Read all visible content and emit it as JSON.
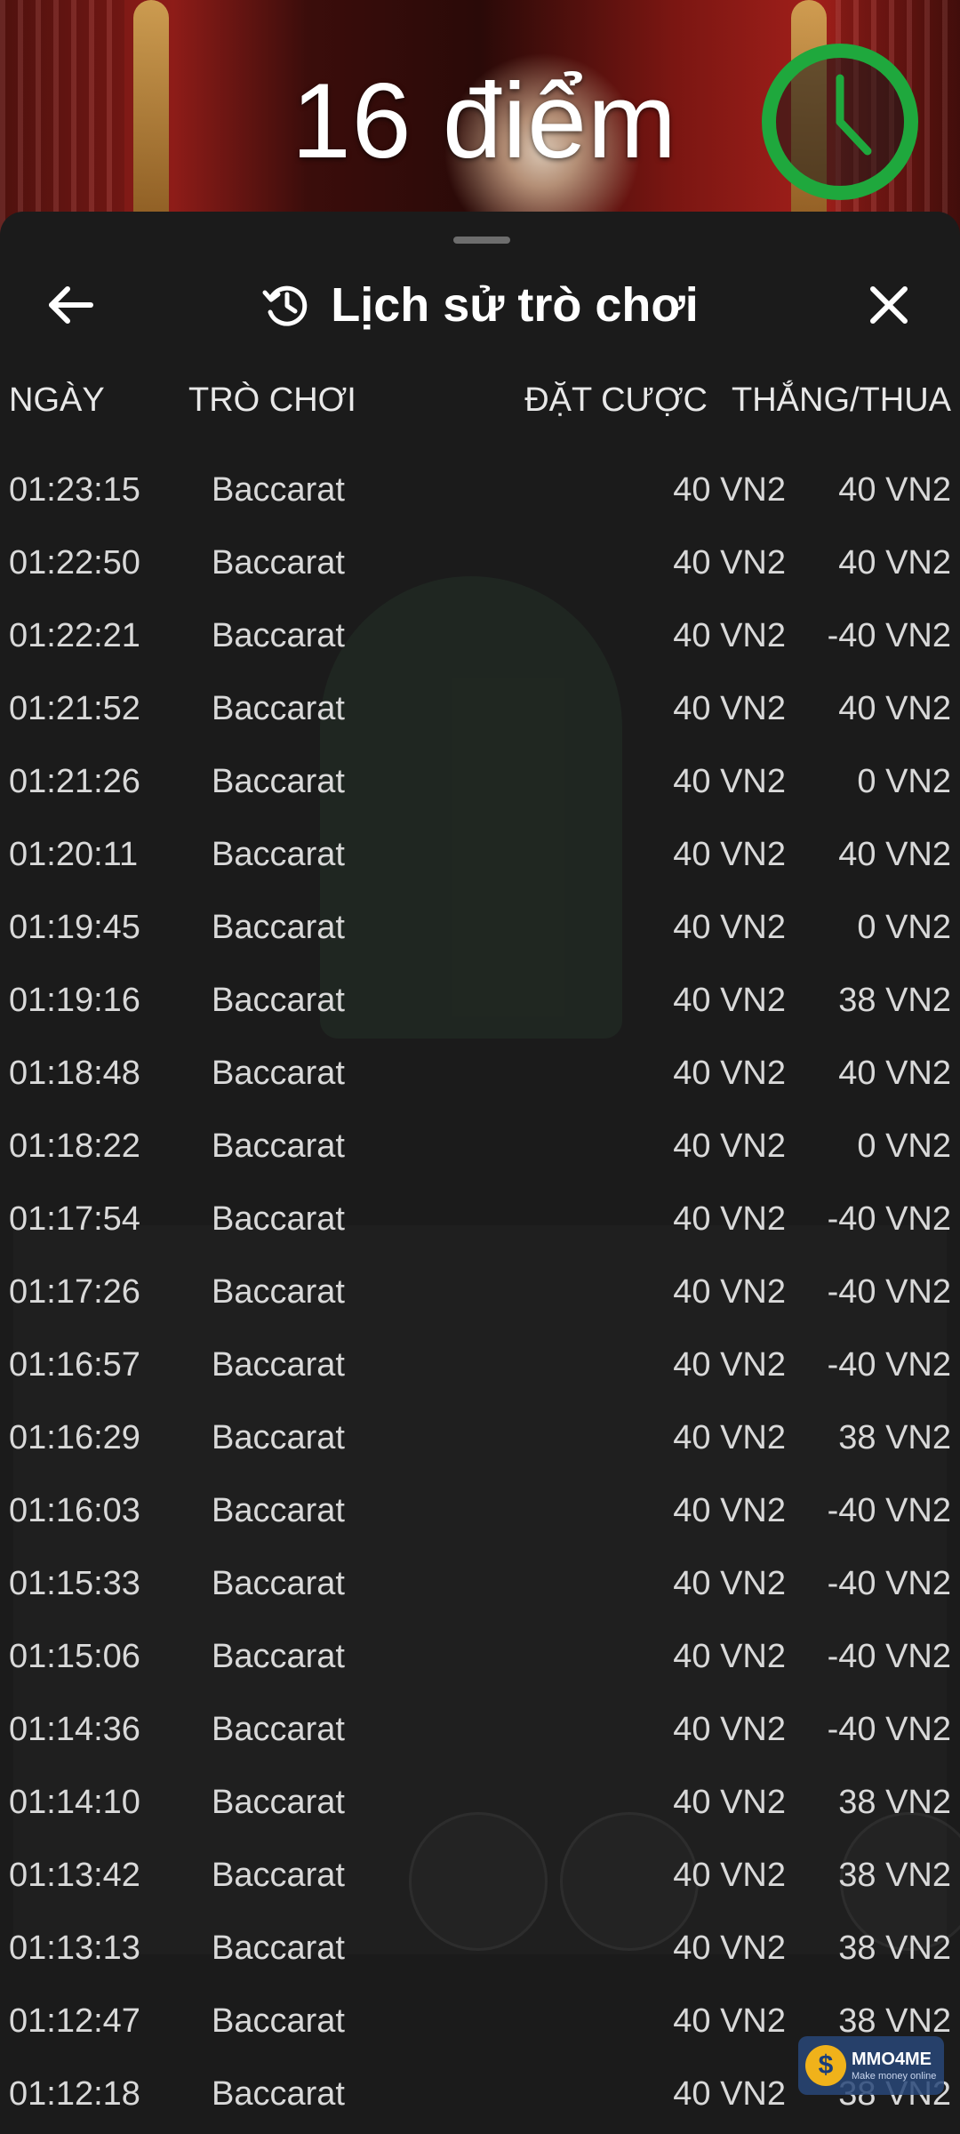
{
  "game": {
    "score_text": "16 điểm",
    "timer_color": "#1fa83d"
  },
  "sheet": {
    "title": "Lịch sử trò chơi",
    "back_icon": "arrow-left-icon",
    "history_icon": "history-icon",
    "close_icon": "close-icon",
    "columns": {
      "date": "NGÀY",
      "game": "TRÒ CHƠI",
      "bet": "ĐẶT CƯỢC",
      "result": "THẮNG/THUA"
    },
    "rows": [
      {
        "time": "01:23:15",
        "game": "Baccarat",
        "bet": "40 VN2",
        "result": "40 VN2"
      },
      {
        "time": "01:22:50",
        "game": "Baccarat",
        "bet": "40 VN2",
        "result": "40 VN2"
      },
      {
        "time": "01:22:21",
        "game": "Baccarat",
        "bet": "40 VN2",
        "result": "-40 VN2"
      },
      {
        "time": "01:21:52",
        "game": "Baccarat",
        "bet": "40 VN2",
        "result": "40 VN2"
      },
      {
        "time": "01:21:26",
        "game": "Baccarat",
        "bet": "40 VN2",
        "result": "0 VN2"
      },
      {
        "time": "01:20:11",
        "game": "Baccarat",
        "bet": "40 VN2",
        "result": "40 VN2"
      },
      {
        "time": "01:19:45",
        "game": "Baccarat",
        "bet": "40 VN2",
        "result": "0 VN2"
      },
      {
        "time": "01:19:16",
        "game": "Baccarat",
        "bet": "40 VN2",
        "result": "38 VN2"
      },
      {
        "time": "01:18:48",
        "game": "Baccarat",
        "bet": "40 VN2",
        "result": "40 VN2"
      },
      {
        "time": "01:18:22",
        "game": "Baccarat",
        "bet": "40 VN2",
        "result": "0 VN2"
      },
      {
        "time": "01:17:54",
        "game": "Baccarat",
        "bet": "40 VN2",
        "result": "-40 VN2"
      },
      {
        "time": "01:17:26",
        "game": "Baccarat",
        "bet": "40 VN2",
        "result": "-40 VN2"
      },
      {
        "time": "01:16:57",
        "game": "Baccarat",
        "bet": "40 VN2",
        "result": "-40 VN2"
      },
      {
        "time": "01:16:29",
        "game": "Baccarat",
        "bet": "40 VN2",
        "result": "38 VN2"
      },
      {
        "time": "01:16:03",
        "game": "Baccarat",
        "bet": "40 VN2",
        "result": "-40 VN2"
      },
      {
        "time": "01:15:33",
        "game": "Baccarat",
        "bet": "40 VN2",
        "result": "-40 VN2"
      },
      {
        "time": "01:15:06",
        "game": "Baccarat",
        "bet": "40 VN2",
        "result": "-40 VN2"
      },
      {
        "time": "01:14:36",
        "game": "Baccarat",
        "bet": "40 VN2",
        "result": "-40 VN2"
      },
      {
        "time": "01:14:10",
        "game": "Baccarat",
        "bet": "40 VN2",
        "result": "38 VN2"
      },
      {
        "time": "01:13:42",
        "game": "Baccarat",
        "bet": "40 VN2",
        "result": "38 VN2"
      },
      {
        "time": "01:13:13",
        "game": "Baccarat",
        "bet": "40 VN2",
        "result": "38 VN2"
      },
      {
        "time": "01:12:47",
        "game": "Baccarat",
        "bet": "40 VN2",
        "result": "38 VN2"
      },
      {
        "time": "01:12:18",
        "game": "Baccarat",
        "bet": "40 VN2",
        "result": "38 VN2"
      }
    ]
  },
  "watermark": {
    "text": "MMO4ME",
    "subtext": "Make money online",
    "symbol": "$"
  }
}
